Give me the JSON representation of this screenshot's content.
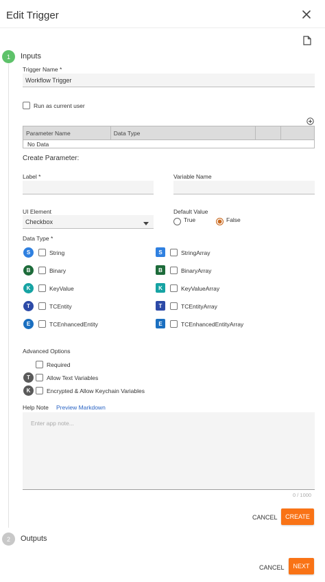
{
  "header": {
    "title": "Edit Trigger"
  },
  "steps": {
    "inputs": {
      "number": "1",
      "label": "Inputs"
    },
    "outputs": {
      "number": "2",
      "label": "Outputs"
    }
  },
  "trigger_name": {
    "label": "Trigger Name *",
    "value": "Workflow Trigger"
  },
  "run_as_current_user": {
    "label": "Run as current user",
    "checked": false
  },
  "param_table": {
    "columns": [
      "Parameter Name",
      "Data Type",
      "",
      ""
    ],
    "empty_text": "No Data"
  },
  "create_parameter": {
    "title": "Create Parameter:",
    "label_field": {
      "label": "Label *",
      "value": ""
    },
    "variable_name": {
      "label": "Variable Name",
      "value": ""
    },
    "ui_element": {
      "label": "UI Element",
      "value": "Checkbox"
    },
    "default_value": {
      "label": "Default Value",
      "true_label": "True",
      "false_label": "False",
      "selected": "False"
    },
    "data_type": {
      "label": "Data Type *",
      "left": [
        {
          "badge": "S",
          "label": "String",
          "color": "#2f80e0"
        },
        {
          "badge": "B",
          "label": "Binary",
          "color": "#1d6b3a"
        },
        {
          "badge": "K",
          "label": "KeyValue",
          "color": "#16a3a3"
        },
        {
          "badge": "T",
          "label": "TCEntity",
          "color": "#2c4aa7"
        },
        {
          "badge": "E",
          "label": "TCEnhancedEntity",
          "color": "#1a6fc0"
        }
      ],
      "right": [
        {
          "badge": "S",
          "label": "StringArray",
          "color": "#2f80e0"
        },
        {
          "badge": "B",
          "label": "BinaryArray",
          "color": "#1d6b3a"
        },
        {
          "badge": "K",
          "label": "KeyValueArray",
          "color": "#16a3a3"
        },
        {
          "badge": "T",
          "label": "TCEntityArray",
          "color": "#2c4aa7"
        },
        {
          "badge": "E",
          "label": "TCEnhancedEntityArray",
          "color": "#1a6fc0"
        }
      ]
    },
    "advanced": {
      "label": "Advanced Options",
      "required": "Required",
      "allow_text": {
        "badge": "T",
        "label": "Allow Text Variables"
      },
      "encrypted": {
        "badge": "K",
        "label": "Encrypted & Allow Keychain Variables"
      }
    },
    "help_note": {
      "label": "Help Note",
      "preview_link": "Preview Markdown",
      "placeholder": "Enter app note...",
      "counter": "0 / 1000"
    },
    "cancel_label": "CANCEL",
    "create_label": "CREATE"
  },
  "footer": {
    "cancel_label": "CANCEL",
    "next_label": "NEXT"
  },
  "colors": {
    "accent": "#f97316",
    "step_active": "#5ec26a",
    "step_inactive": "#c8c8c8"
  }
}
